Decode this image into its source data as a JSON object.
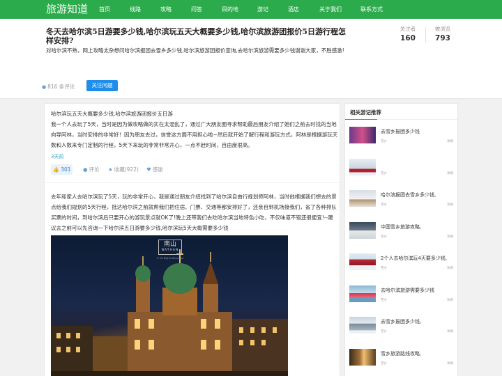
{
  "brand": {
    "logo": "旅游知道"
  },
  "nav": {
    "items": [
      {
        "label": "首页"
      },
      {
        "label": "线路"
      },
      {
        "label": "攻略"
      },
      {
        "label": "问答"
      },
      {
        "label": "目的地"
      },
      {
        "label": "游记"
      },
      {
        "label": "酒店"
      },
      {
        "label": "关于我们"
      },
      {
        "label": "联系方式"
      }
    ]
  },
  "question": {
    "title": "冬天去哈尔滨5日游要多少钱,哈尔滨玩五天大概要多少钱,哈尔滨旅游团报价5日游行程怎样安排?",
    "description": "对哈尔滨不熟，网上攻略太杂想问哈尔滨报团去雪乡多少钱,哈尔滨旅游团报价查询,去哈尔滨旅游需要多少钱谢谢大家，不胜感激!",
    "stats": {
      "followers_label": "关注者",
      "followers_value": "160",
      "views_label": "被浏览",
      "views_value": "793"
    },
    "comments_text": "816 条评论",
    "follow_button": "关注问题"
  },
  "answer1": {
    "title": "哈尔滨玩五天大概要多少钱,哈尔滨旅游团报价五日游",
    "body": "我一个人去玩了5天，当时是因为做攻略做的实在太混乱了，通过广大朋友圈寻求帮助最后朋友介绍了她们之前去时找的当地向导阿林，当时安排的非常好！因为朋友去过，信誉这方面不用担心啦~然后就开始了解行程和游玩方式，阿林是根据游玩天数和人数来专门定制的行程，5天下来玩的非常非常开心，一点不赶时间，自由度很高。",
    "time": "3天前",
    "like_count": "301",
    "comment_label": "评论",
    "favorite_label": "收藏(922)",
    "thanks_label": "感谢"
  },
  "answer2": {
    "body": "去年和家人去哈尔滨玩了5天，玩的非常开心，我是通过朋友介绍找到了哈尔滨自由行规划师阿林，当时他根据我们想去的景点给我们规划的5天行程，抵达哈尔滨之前就帮我们把住宿、门票、交通等都安排好了，还亲自到机场接我们，省了各种排队买票的时间，到哈尔滨后只要开心的游玩景点就OK了!晚上还带我们去吃哈尔滨当地特色小吃，不仅味道不错还很便宜!--建议去之前可以先咨询一下哈尔滨五日游要多少钱,哈尔滨玩5天大概需要多少钱",
    "photo_brand": "南山",
    "photo_brand_sub": "NATHAN",
    "photo_rights": "© All Rights Reserved"
  },
  "sidebar": {
    "title": "相关游记推荐",
    "items": [
      {
        "title": "去雪乡报团多少钱",
        "meta": "雪乡",
        "meta2": "攻略"
      },
      {
        "title": "",
        "meta": "雪乡",
        "meta2": "攻略"
      },
      {
        "title": "哈尔滨报团去雪乡多少钱,",
        "meta": "雪乡",
        "meta2": "攻略"
      },
      {
        "title": "中国雪乡旅游攻略,",
        "meta": "雪乡",
        "meta2": "攻略"
      },
      {
        "title": "2个人去哈尔滨玩4天要多少钱,",
        "meta": "雪乡",
        "meta2": "攻略"
      },
      {
        "title": "去哈尔滨旅游需要多少钱",
        "meta": "雪乡",
        "meta2": "攻略"
      },
      {
        "title": "去雪乡报团多少钱,",
        "meta": "雪乡",
        "meta2": "攻略"
      },
      {
        "title": "雪乡旅游路线攻略,",
        "meta": "雪乡",
        "meta2": "攻略"
      }
    ]
  },
  "colors": {
    "brand_green": "#2bab4c",
    "accent_blue": "#1f8eeb"
  }
}
